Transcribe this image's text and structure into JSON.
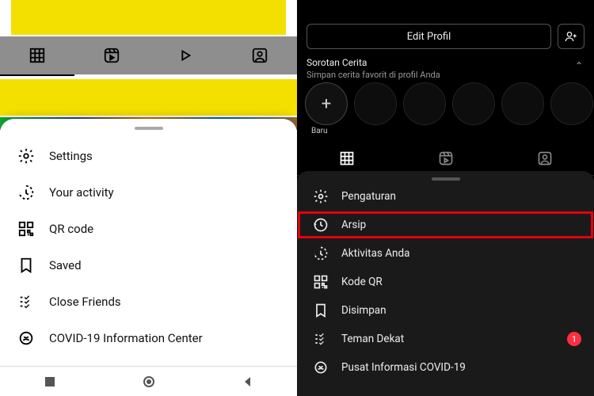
{
  "left": {
    "tabs": [
      "grid",
      "reels",
      "video",
      "tagged"
    ],
    "menu": [
      {
        "key": "settings",
        "label": "Settings",
        "icon": "gear-icon"
      },
      {
        "key": "activity",
        "label": "Your activity",
        "icon": "activity-icon"
      },
      {
        "key": "qr",
        "label": "QR code",
        "icon": "qr-icon"
      },
      {
        "key": "saved",
        "label": "Saved",
        "icon": "bookmark-icon"
      },
      {
        "key": "close",
        "label": "Close Friends",
        "icon": "close-friends-icon"
      },
      {
        "key": "covid",
        "label": "COVID-19 Information Center",
        "icon": "covid-icon"
      }
    ]
  },
  "right": {
    "edit_profile_label": "Edit Profil",
    "highlights": {
      "title": "Sorotan Cerita",
      "subtitle": "Simpan cerita favorit di profil Anda",
      "new_label": "Baru"
    },
    "tabs": [
      "grid",
      "reels",
      "tagged"
    ],
    "menu": [
      {
        "key": "pengaturan",
        "label": "Pengaturan",
        "icon": "gear-icon",
        "highlighted": false
      },
      {
        "key": "arsip",
        "label": "Arsip",
        "icon": "archive-icon",
        "highlighted": true
      },
      {
        "key": "aktivitas",
        "label": "Aktivitas Anda",
        "icon": "activity-icon",
        "highlighted": false
      },
      {
        "key": "kodeqr",
        "label": "Kode QR",
        "icon": "qr-icon",
        "highlighted": false
      },
      {
        "key": "disimpan",
        "label": "Disimpan",
        "icon": "bookmark-icon",
        "highlighted": false
      },
      {
        "key": "teman",
        "label": "Teman Dekat",
        "icon": "close-friends-icon",
        "highlighted": false,
        "badge": "1"
      },
      {
        "key": "covid",
        "label": "Pusat Informasi COVID-19",
        "icon": "covid-icon",
        "highlighted": false
      }
    ]
  }
}
